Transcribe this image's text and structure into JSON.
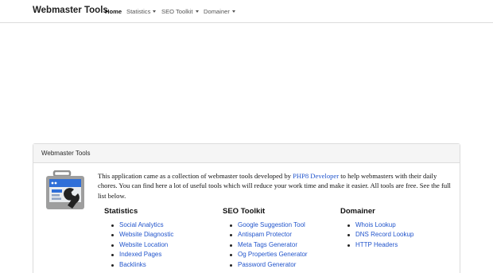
{
  "navbar": {
    "brand": "Webmaster Tools",
    "items": [
      {
        "label": "Home",
        "active": true,
        "dropdown": false
      },
      {
        "label": "Statistics",
        "active": false,
        "dropdown": true
      },
      {
        "label": "SEO Toolkit",
        "active": false,
        "dropdown": true
      },
      {
        "label": "Domainer",
        "active": false,
        "dropdown": true
      }
    ]
  },
  "card": {
    "title": "Webmaster Tools",
    "intro_before": "This application came as a collection of webmaster tools developed by ",
    "intro_link": "PHP8 Developer",
    "intro_after": " to help webmasters with their daily chores. You can find here a lot of useful tools which will reduce your work time and make it easier. All tools are free. See the full list below."
  },
  "columns": [
    {
      "title": "Statistics",
      "items": [
        "Social Analytics",
        "Website Diagnostic",
        "Website Location",
        "Indexed Pages",
        "Backlinks"
      ]
    },
    {
      "title": "SEO Toolkit",
      "items": [
        "Google Suggestion Tool",
        "Antispam Protector",
        "Meta Tags Generator",
        "Og Properties Generator",
        "Password Generator"
      ]
    },
    {
      "title": "Domainer",
      "items": [
        "Whois Lookup",
        "DNS Record Lookup",
        "HTTP Headers"
      ]
    }
  ],
  "colors": {
    "link": "#2255cc",
    "logo_blue": "#2f6fd8",
    "logo_gray": "#9e9e9e"
  },
  "icons": {
    "logo": "toolbox-wrench-icon",
    "dropdown": "caret-down-icon"
  }
}
